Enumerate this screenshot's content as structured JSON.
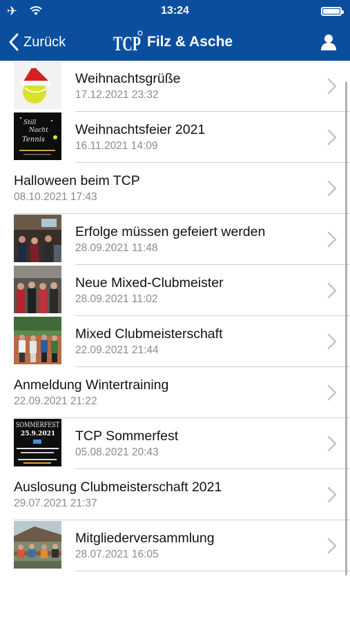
{
  "status_bar": {
    "time": "13:24"
  },
  "nav": {
    "back_label": "Zurück",
    "brand_title": "Filz & Asche",
    "brand_logo_text": "TCP",
    "color": "#0b4e9e"
  },
  "news": [
    {
      "title": "Weihnachtsgrüße",
      "date": "17.12.2021 23:32",
      "thumb": "tennisball-santa-hat"
    },
    {
      "title": "Weihnachtsfeier 2021",
      "date": "16.11.2021 14:09",
      "thumb": "christmas-party-flyer"
    },
    {
      "title": "Halloween beim TCP",
      "date": "08.10.2021 17:43",
      "thumb": null
    },
    {
      "title": "Erfolge müssen gefeiert werden",
      "date": "28.09.2021 11:48",
      "thumb": "party-photo"
    },
    {
      "title": "Neue Mixed-Clubmeister",
      "date": "28.09.2021 11:02",
      "thumb": "group-photo"
    },
    {
      "title": "Mixed Clubmeisterschaft",
      "date": "22.09.2021 21:44",
      "thumb": "tennis-court-photo"
    },
    {
      "title": "Anmeldung Wintertraining",
      "date": "22.09.2021 21:22",
      "thumb": null
    },
    {
      "title": "TCP Sommerfest",
      "date": "05.08.2021 20:43",
      "thumb": "sommerfest-flyer"
    },
    {
      "title": "Auslosung Clubmeisterschaft 2021",
      "date": "29.07.2021 21:37",
      "thumb": null
    },
    {
      "title": "Mitgliederversammlung",
      "date": "28.07.2021 16:05",
      "thumb": "meeting-photo"
    }
  ],
  "thumb_text": {
    "weihnachtsfeier": [
      "Still",
      "Nacht",
      "Tennis"
    ],
    "sommerfest": [
      "SOMMERFEST",
      "25.9.2021"
    ]
  }
}
